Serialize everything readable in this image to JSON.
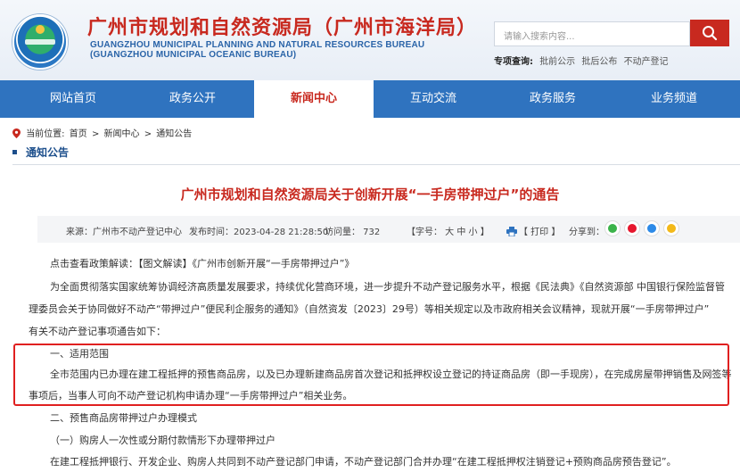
{
  "header": {
    "bureau_cn": "广州市规划和自然资源局（广州市海洋局）",
    "bureau_en_line1": "GUANGZHOU MUNICIPAL PLANNING AND NATURAL RESOURCES BUREAU",
    "bureau_en_line2": "(GUANGZHOU MUNICIPAL OCEANIC BUREAU)",
    "search_placeholder": "请输入搜索内容...",
    "quick_label": "专项查询:",
    "quick_links": [
      "批前公示",
      "批后公布",
      "不动产登记"
    ]
  },
  "nav": {
    "items": [
      {
        "label": "网站首页",
        "active": false
      },
      {
        "label": "政务公开",
        "active": false
      },
      {
        "label": "新闻中心",
        "active": true
      },
      {
        "label": "互动交流",
        "active": false
      },
      {
        "label": "政务服务",
        "active": false
      },
      {
        "label": "业务频道",
        "active": false
      }
    ]
  },
  "breadcrumb": {
    "prefix": "当前位置:",
    "items": [
      "首页",
      "新闻中心",
      "通知公告"
    ],
    "separator": ">"
  },
  "section_title": "通知公告",
  "article": {
    "title": "广州市规划和自然资源局关于创新开展“一手房带押过户”的通告",
    "meta": {
      "source": "来源：广州市不动产登记中心",
      "published": "发布时间：2023-04-28 21:28:50",
      "views": "访问量：  732",
      "font_size": "【字号：  大  中  小  】",
      "print": "【 打印 】",
      "share_label": "分享到："
    },
    "paragraphs": [
      "点击查看政策解读：【图文解读】《广州市创新开展“一手房带押过户”》",
      "为全面贯彻落实国家统筹协调经济高质量发展要求，持续优化营商环境，进一步提升不动产登记服务水平，根据《民法典》《自然资源部 中国银行保险监督管",
      "理委员会关于协同做好不动产“带押过户”便民利企服务的通知》（自然资发〔2023〕29号）等相关规定以及市政府相关会议精神，现就开展“一手房带押过户”",
      "有关不动产登记事项通告如下：",
      "一、适用范围",
      "全市范围内已办理在建工程抵押的预售商品房，以及已办理新建商品房首次登记和抵押权设立登记的持证商品房（即一手现房），在完成房屋带押销售及网签等",
      "事项后，当事人可向不动产登记机构申请办理“一手房带押过户”相关业务。",
      "二、预售商品房带押过户办理模式",
      "（一）购房人一次性或分期付款情形下办理带押过户",
      "在建工程抵押银行、开发企业、购房人共同到不动产登记部门申请，不动产登记部门合并办理“在建工程抵押权注销登记+预购商品房预告登记”。"
    ]
  },
  "colors": {
    "brand_red": "#c8291f",
    "nav_blue": "#2f73bf",
    "highlight_red": "#e02020"
  },
  "icons": [
    "location-pin-icon",
    "search-icon",
    "print-icon",
    "wechat-icon",
    "weibo-icon",
    "qq-icon",
    "qzone-icon"
  ]
}
